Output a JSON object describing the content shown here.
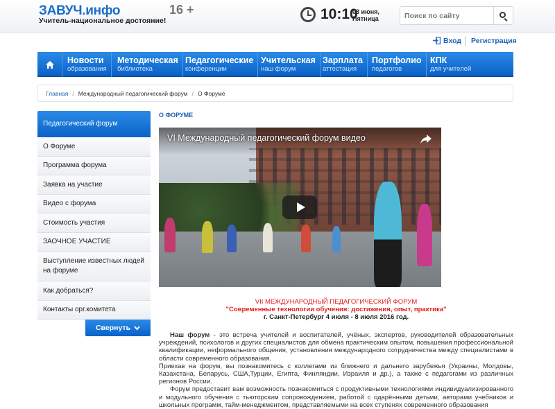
{
  "header": {
    "logo": "ЗАВУЧ.инфо",
    "slogan": "Учитель-национальное достояние!",
    "age_rating": "16 +",
    "time": "10:10",
    "date_line1": "03 июня,",
    "date_line2": "Пятница",
    "search_placeholder": "Поиск по сайту"
  },
  "auth": {
    "login": "Вход",
    "register": "Регистрация"
  },
  "nav": {
    "items": [
      {
        "title": "Новости",
        "sub": "образования"
      },
      {
        "title": "Методическая",
        "sub": "библиотека"
      },
      {
        "title": "Педагогические",
        "sub": "конференции"
      },
      {
        "title": "Учительская",
        "sub": "наш форум"
      },
      {
        "title": "Зарплата",
        "sub": "аттестация"
      },
      {
        "title": "Портфолио",
        "sub": "педагогов"
      },
      {
        "title": "КПК",
        "sub": "для учителей"
      }
    ]
  },
  "breadcrumb": {
    "home": "Главная",
    "sep": "/",
    "level2": "Международный педагогический форум",
    "current": "О Форуме"
  },
  "sidebar": {
    "header": "Педагогический форум",
    "items": [
      "О Форуме",
      "Программа форума",
      "Заявка на участие",
      "Видео с форума",
      "Стоимость участия",
      "ЗАОЧНОЕ УЧАСТИЕ",
      "Выступление известных людей на форуме",
      "Как добраться?",
      "Контакты орг.комитета"
    ],
    "collapse": "Свернуть"
  },
  "main": {
    "page_title": "О ФОРУМЕ",
    "video_title": "VI Международный педагогический форум видео",
    "forum_name": "VII МЕЖДУНАРОДНЫЙ ПЕДАГОГИЧЕСКИЙ ФОРУМ",
    "forum_theme": "\"Современные технологии обучения: достижения, опыт, практика\"",
    "forum_place": "г. Санкт-Петербург 4 июля - 8 июля 2016 год.",
    "p1_bold": "Наш форум",
    "p1_rest": " - это встреча учителей и воспитателей, учёных, экспертов, руководителей образовательных учреждений, психологов и других специалистов для обмена практическим опытом, повышения профессиональной квалификации, неформального общения, установления международного сотрудничества между специалистами в области современного образования.",
    "p2": "Приехав на форум, вы познакомитесь с коллегами из ближнего и дальнего зарубежья (Украины, Молдовы, Казахстана, Беларусь, США,Турции, Египта, Финляндии, Израиля и др.), а также с педагогами из различных регионов России.",
    "p3": "Форум предоставит вам возможность познакомиться с продуктивными технологиями индивидуализированного и модульного обучения с тьюторским сопровождением, работой с одарёнными детьми, авторами учебников и школьных программ, тайм-менеджментом, представляемыми на всех ступенях современного образования"
  },
  "colors": {
    "brand_blue": "#1a6ec8",
    "nav_blue": "#0b62c8",
    "accent_red": "#e0201b"
  }
}
